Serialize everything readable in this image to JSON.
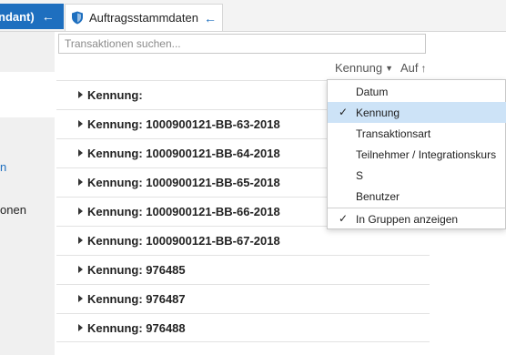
{
  "tabs": {
    "left_tab_label": "ndant)",
    "left_tab_arrow": "←",
    "active_tab_title": "Auftragsstammdaten",
    "active_tab_arrow": "←"
  },
  "sidebar": {
    "item_1_fragment": "n",
    "item_2_fragment": "onen"
  },
  "search": {
    "placeholder": "Transaktionen suchen...",
    "value": ""
  },
  "sort": {
    "field_label": "Kennung",
    "direction_label": "Auf",
    "direction_arrow": "↑"
  },
  "list": {
    "rows": [
      "Kennung:",
      "Kennung: 1000900121-BB-63-2018",
      "Kennung: 1000900121-BB-64-2018",
      "Kennung: 1000900121-BB-65-2018",
      "Kennung: 1000900121-BB-66-2018",
      "Kennung: 1000900121-BB-67-2018",
      "Kennung: 976485",
      "Kennung: 976487",
      "Kennung: 976488"
    ]
  },
  "menu": {
    "items": [
      {
        "label": "Datum",
        "checked": false
      },
      {
        "label": "Kennung",
        "checked": true
      },
      {
        "label": "Transaktionsart",
        "checked": false
      },
      {
        "label": "Teilnehmer / Integrationskurs",
        "checked": false
      },
      {
        "label": "S",
        "checked": false
      },
      {
        "label": "Benutzer",
        "checked": false
      },
      {
        "label": "In Gruppen anzeigen",
        "checked": true
      }
    ],
    "check_glyph": "✓"
  },
  "colors": {
    "accent": "#1e6fbf",
    "highlight": "#cde3f7"
  }
}
